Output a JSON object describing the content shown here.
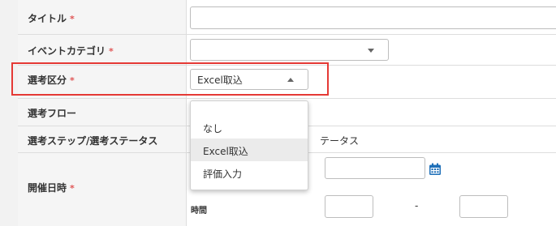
{
  "form": {
    "title": {
      "label": "タイトル",
      "required_mark": "*",
      "value": ""
    },
    "event_category": {
      "label": "イベントカテゴリ",
      "required_mark": "*",
      "value": ""
    },
    "selection_type": {
      "label": "選考区分",
      "required_mark": "*",
      "value": "Excel取込",
      "options": [
        "なし",
        "Excel取込",
        "評価入力"
      ],
      "highlighted_option": "Excel取込"
    },
    "selection_flow": {
      "label": "選考フロー"
    },
    "selection_step_status": {
      "label": "選考ステップ/選考ステータス",
      "partial_value": "テータス"
    },
    "event_datetime": {
      "label": "開催日時",
      "required_mark": "*",
      "date_value": "",
      "time_label": "時間",
      "time_separator": "-",
      "time_start": "",
      "time_end": ""
    }
  },
  "colors": {
    "highlight_border": "#e53935",
    "required_mark": "#e05555",
    "calendar_icon": "#1e6fb8"
  },
  "icons": [
    "chevron-down-icon",
    "chevron-up-icon",
    "calendar-icon"
  ]
}
